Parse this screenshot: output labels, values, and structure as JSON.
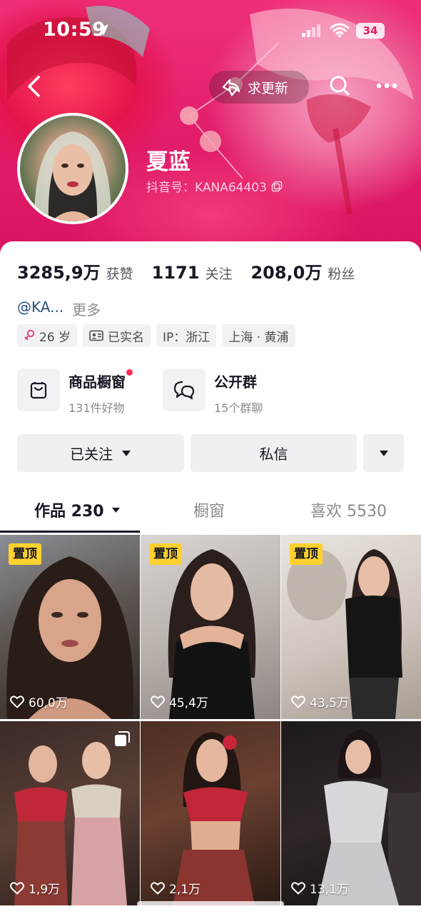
{
  "status_bar": {
    "time": "10:59",
    "battery": "34"
  },
  "header": {
    "update_label": "求更新",
    "display_name": "夏蓝",
    "douyin_id_label": "抖音号：KANA64403"
  },
  "stats": [
    {
      "value": "3285,9万",
      "label": "获赞"
    },
    {
      "value": "1171",
      "label": "关注"
    },
    {
      "value": "208,0万",
      "label": "粉丝"
    }
  ],
  "bio": {
    "handle": "@KA...",
    "more": "更多"
  },
  "tags": [
    {
      "icon": "female-icon",
      "text": "26 岁"
    },
    {
      "icon": "id-card-icon",
      "text": "已实名"
    },
    {
      "icon": "",
      "text": "IP：浙江"
    },
    {
      "icon": "",
      "text": "上海 · 黄浦"
    }
  ],
  "features": {
    "shop": {
      "title": "商品橱窗",
      "subtitle": "131件好物",
      "icon": "shopping-bag-icon"
    },
    "group": {
      "title": "公开群",
      "subtitle": "15个群聊",
      "icon": "chat-bubbles-icon"
    }
  },
  "actions": {
    "followed": "已关注",
    "message": "私信"
  },
  "tabs": [
    {
      "label": "作品 230",
      "active": true
    },
    {
      "label": "橱窗",
      "active": false
    },
    {
      "label": "喜欢 5530",
      "active": false
    }
  ],
  "posts": [
    {
      "pinned": "置顶",
      "likes": "60,0万"
    },
    {
      "pinned": "置顶",
      "likes": "45,4万"
    },
    {
      "pinned": "置顶",
      "likes": "43,5万"
    },
    {
      "pinned": "",
      "likes": "1,9万",
      "multi": true
    },
    {
      "pinned": "",
      "likes": "2,1万"
    },
    {
      "pinned": "",
      "likes": "13,1万"
    }
  ],
  "colors": {
    "brand_pink": "#e21d6a",
    "pin_yellow": "#ffd12e",
    "dot_red": "#fe2c55"
  }
}
